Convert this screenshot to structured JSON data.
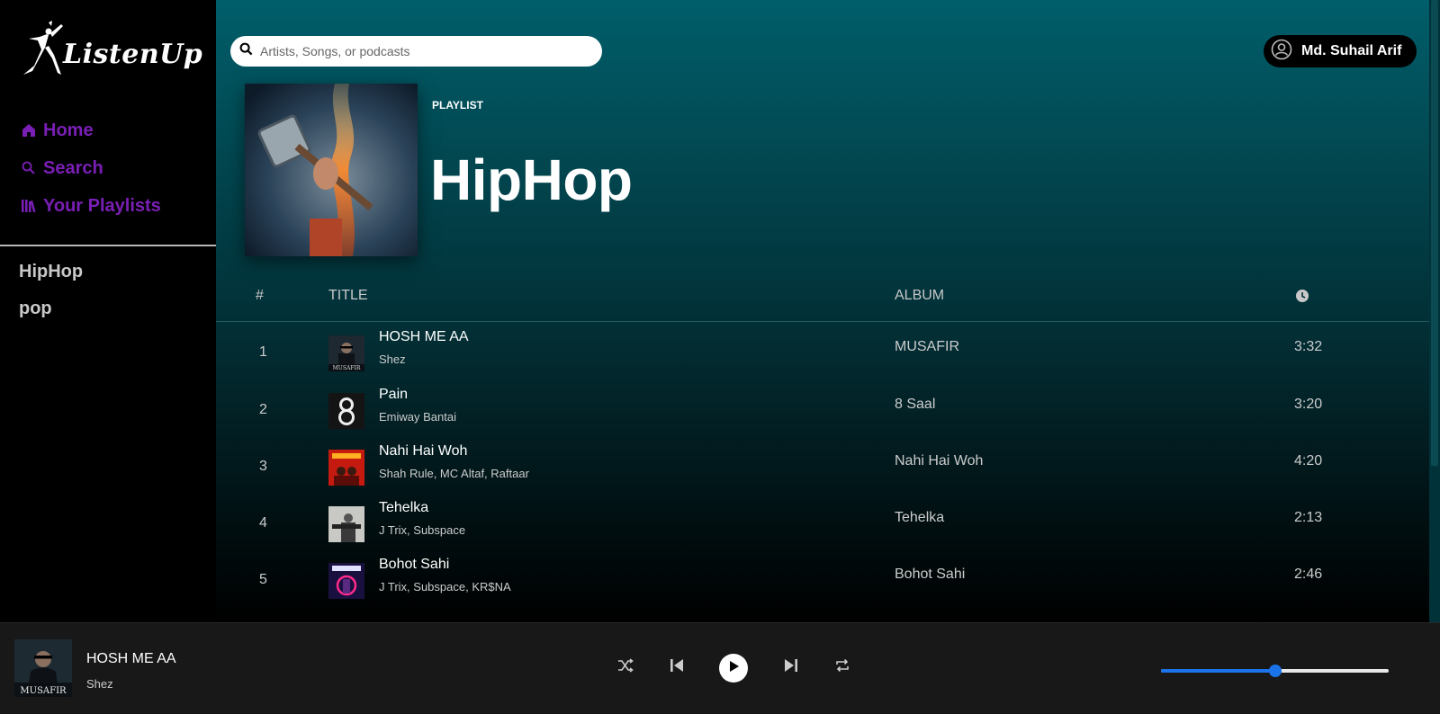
{
  "app": {
    "name": "ListenUp"
  },
  "sidebar": {
    "nav": [
      {
        "label": "Home",
        "icon": "home-icon"
      },
      {
        "label": "Search",
        "icon": "search-icon"
      },
      {
        "label": "Your Playlists",
        "icon": "library-icon"
      }
    ],
    "playlists": [
      "HipHop",
      "pop"
    ],
    "accent_color": "#7a1fb5"
  },
  "search": {
    "placeholder": "Artists, Songs, or podcasts"
  },
  "user": {
    "name": "Md. Suhail Arif"
  },
  "playlist": {
    "kind": "PLAYLIST",
    "title": "HipHop",
    "columns": {
      "num": "#",
      "title": "TITLE",
      "album": "ALBUM",
      "duration_icon": "clock-icon"
    },
    "tracks": [
      {
        "num": "1",
        "title": "HOSH ME AA",
        "artist": "Shez",
        "album": "MUSAFIR",
        "duration": "3:32",
        "art": "musafir"
      },
      {
        "num": "2",
        "title": "Pain",
        "artist": "Emiway Bantai",
        "album": "8 Saal",
        "duration": "3:20",
        "art": "8saal"
      },
      {
        "num": "3",
        "title": "Nahi Hai Woh",
        "artist": "Shah Rule, MC Altaf, Raftaar",
        "album": "Nahi Hai Woh",
        "duration": "4:20",
        "art": "nahi"
      },
      {
        "num": "4",
        "title": "Tehelka",
        "artist": "J Trix, Subspace",
        "album": "Tehelka",
        "duration": "2:13",
        "art": "tehelka"
      },
      {
        "num": "5",
        "title": "Bohot Sahi",
        "artist": "J Trix, Subspace, KR$NA",
        "album": "Bohot Sahi",
        "duration": "2:46",
        "art": "bohot"
      }
    ]
  },
  "player": {
    "now_playing": {
      "title": "HOSH ME AA",
      "artist": "Shez",
      "art_text": "MUSAFIR"
    },
    "controls": [
      "shuffle-icon",
      "previous-icon",
      "play-icon",
      "next-icon",
      "repeat-icon"
    ],
    "volume": 0.5,
    "volume_color": "#1a73e8"
  }
}
